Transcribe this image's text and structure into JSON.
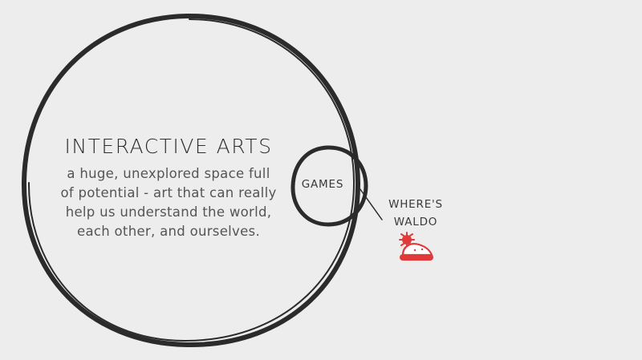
{
  "diagram": {
    "outer_label": "INTERACTIVE ARTS",
    "outer_description": [
      "a huge, unexplored space full",
      "of potential - art that can really",
      "help us understand the world,",
      "each other, and ourselves."
    ],
    "inner_label": "GAMES",
    "pointer_label": [
      "WHERE'S",
      "WALDO"
    ],
    "hat_icon": "waldo-hat-icon"
  },
  "colors": {
    "background": "#ededed",
    "stroke": "#2b2b2b",
    "hat_red": "#e03a3a",
    "hat_white": "#ffffff"
  }
}
